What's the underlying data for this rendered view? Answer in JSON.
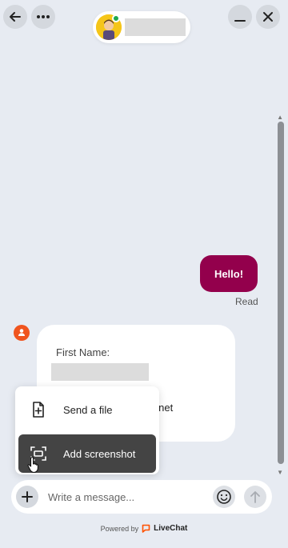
{
  "header": {
    "back_icon": "arrow-left-icon",
    "more_icon": "more-dots-icon",
    "minimize_icon": "minimize-icon",
    "close_icon": "close-icon"
  },
  "colors": {
    "background": "#e7ebf2",
    "visitor_bubble": "#93004c",
    "online": "#1fa84d",
    "bot_avatar": "#f0541e",
    "livechat_brand": "#ff5100"
  },
  "messages": {
    "visitor_message": "Hello!",
    "read_status": "Read"
  },
  "form_card": {
    "first_name_label": "First Name:",
    "email_tail": "x.net"
  },
  "attachment_menu": {
    "items": [
      {
        "label": "Send a file",
        "icon": "file-plus-icon"
      },
      {
        "label": "Add screenshot",
        "icon": "screenshot-icon"
      }
    ]
  },
  "composer": {
    "placeholder": "Write a message...",
    "plus_icon": "plus-icon",
    "emoji_icon": "smiley-icon",
    "send_icon": "arrow-up-icon"
  },
  "footer": {
    "powered_by": "Powered by",
    "brand": "LiveChat"
  }
}
